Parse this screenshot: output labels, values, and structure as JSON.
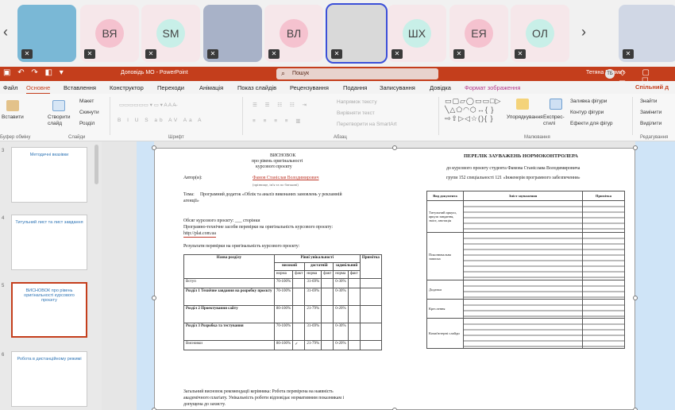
{
  "participants": [
    {
      "initials": "",
      "color": "#7ab8d6"
    },
    {
      "initials": "ВЯ",
      "color": "#f5c2cf"
    },
    {
      "initials": "SM",
      "color": "#c8efe8"
    },
    {
      "initials": "",
      "color": "#a8b2c8"
    },
    {
      "initials": "ВЛ",
      "color": "#f5c2cf"
    },
    {
      "initials": "",
      "color": "#d9d9d9"
    },
    {
      "initials": "ШХ",
      "color": "#c8efe8"
    },
    {
      "initials": "ЕЯ",
      "color": "#f5c2cf"
    },
    {
      "initials": "ОЛ",
      "color": "#c8efe8"
    },
    {
      "initials": "",
      "color": "#d0d7e5"
    }
  ],
  "titlebar": {
    "document": "Доповідь МО - PowerPoint",
    "search": "Пошук",
    "user": "Тетяна Балмит",
    "badge": "ТБ"
  },
  "tabs": [
    "Файл",
    "Основне",
    "Вставлення",
    "Конструктор",
    "Переходи",
    "Анімація",
    "Показ слайдів",
    "Рецензування",
    "Подання",
    "Записування",
    "Довідка",
    "Формат зображення"
  ],
  "share_label": "Спільний д",
  "ribbon": {
    "paste": "Вставити",
    "new_slide": "Створити слайд",
    "layout": "Макет",
    "reset": "Скинути",
    "section": "Розділ",
    "arrange": "Упорядкування",
    "quick_styles": "Експрес-стилі",
    "fill": "Заливка фігури",
    "outline": "Контур фігури",
    "effects": "Ефекти для фігур",
    "find": "Знайти",
    "replace": "Замінити",
    "select": "Виділити",
    "text_dir": "Напрямок тексту",
    "align_text": "Вирівняти текст",
    "smartart": "Перетворити на SmartArt",
    "groups": {
      "clipboard": "Буфер обміну",
      "slides": "Слайди",
      "font": "Шрифт",
      "paragraph": "Абзац",
      "drawing": "Малювання",
      "editing": "Редагування"
    }
  },
  "slides": [
    {
      "num": "3",
      "title": "Методичні вказівки"
    },
    {
      "num": "4",
      "title": "Титульний лист та лист завдання"
    },
    {
      "num": "5",
      "title": "ВИСНОВОК про рівень оригінальності курсового проєкту"
    },
    {
      "num": "6",
      "title": "Робота в дистанційному режимі"
    }
  ],
  "left": {
    "h1": "ВИСНОВОК",
    "h2": "про рівень оригінальності",
    "h3": "курсового проєкту",
    "author_label": "Автор(и):",
    "author_name": "Фамов Станіслав Володимирович",
    "author_hint": "(прізвище, ім'я та по батькові)",
    "topic_label": "Тема:",
    "topic": "Програмний додаток «Облік та аналіз виконаних замовлень у рекламній",
    "topic2": "агенції»",
    "volume": "Обсяг курсового проєкту: ___ сторінки",
    "tool": "Програмно-технічне засоби перевірки на оригінальність курсового проєкту:",
    "tool2": "http://plat.com.ua",
    "results": "Результати перевірки на оригінальність курсового проєкту:",
    "table_h_section": "Назва розділу",
    "table_h_levels": "Рівні унікальності",
    "table_h_note": "Примітка",
    "levels": [
      "високий",
      "достатній",
      "задовільний"
    ],
    "norm": "норма",
    "fact": "факт",
    "rows": [
      {
        "name": "Вступ",
        "v": [
          "70-100%",
          "",
          "31-69%",
          "",
          "0-30%",
          ""
        ]
      },
      {
        "name": "Розділ 1 Технічне завдання на розробку проєкту",
        "v": [
          "70-100%",
          "",
          "31-69%",
          "",
          "0-30%",
          ""
        ]
      },
      {
        "name": "Розділ 2 Проектування сайту",
        "v": [
          "80-100%",
          "",
          "21-79%",
          "",
          "0-20%",
          ""
        ]
      },
      {
        "name": "Розділ 3 Розробка та тестування",
        "v": [
          "70-100%",
          "",
          "31-69%",
          "",
          "0-30%",
          ""
        ]
      },
      {
        "name": "Висновки",
        "v": [
          "80-100%",
          "✓",
          "21-79%",
          "",
          "0-20%",
          ""
        ]
      }
    ],
    "conclusion": "Загальний висновок рекомендації керівника: Робота перевірена на наявність",
    "conclusion2": "академічного плагіату. Унікальність роботи відповідає нормативним показникам і",
    "conclusion3": "допущена до захисту."
  },
  "right": {
    "title": "ПЕРЕЛІК ЗАУВАЖЕНЬ НОРМОКОНТРОЛЕРА",
    "line1": "до курсового проєкту студента Фамова Станіслава Володимировича",
    "line2": "групи 152 спеціальності 121 «Інженерія програмного забезпечення»",
    "cols": [
      "Вид документа",
      "Зміст зауваження",
      "Примітка"
    ],
    "rows": [
      "Титульний аркуш, аркуш завдання, зміст, анотація",
      "Пояснювальна записка",
      "Додатки",
      "Креслення",
      "Комп'ютерні слайди"
    ]
  }
}
